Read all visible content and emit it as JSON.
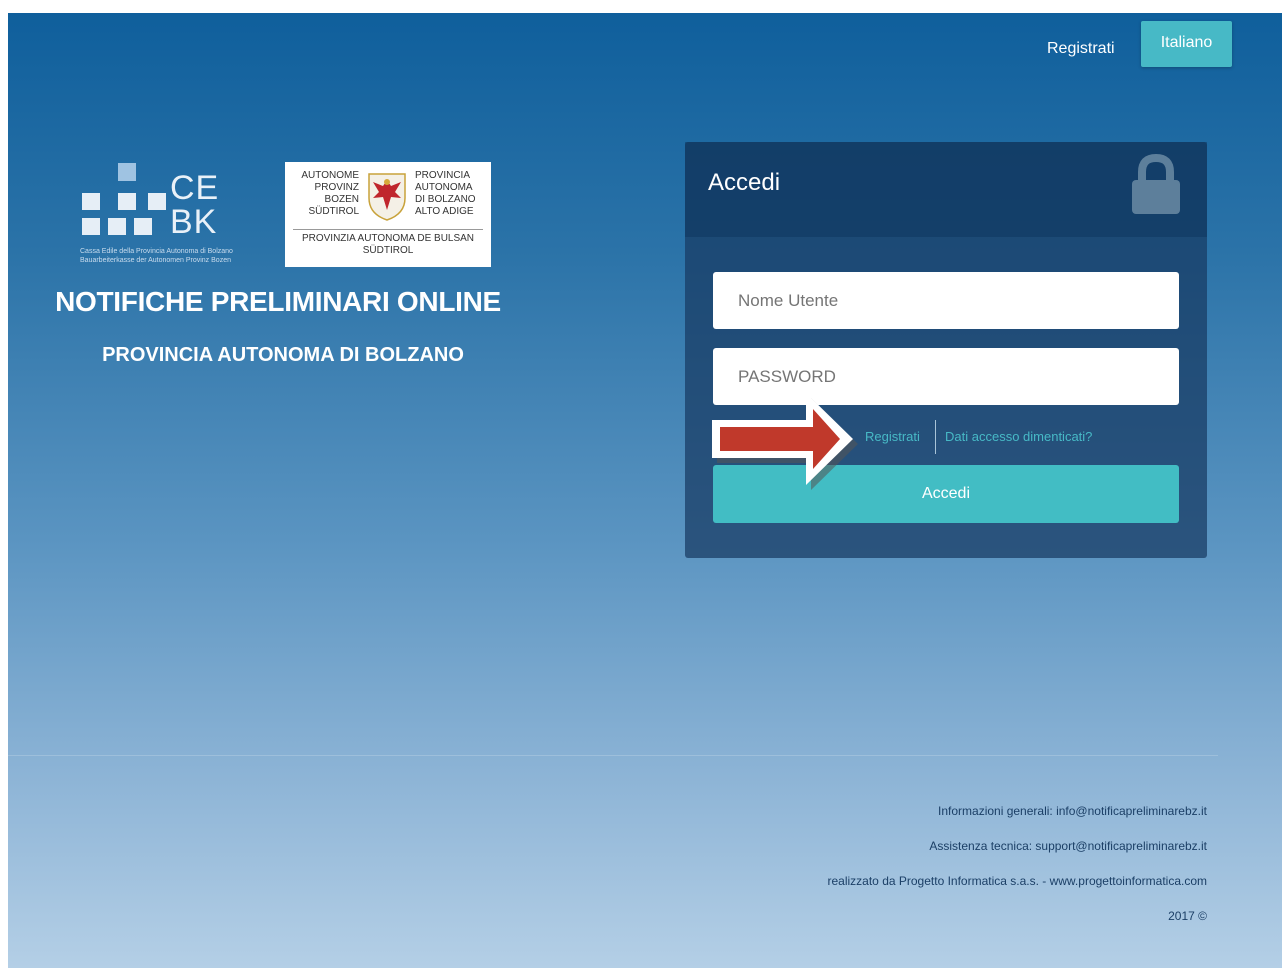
{
  "nav": {
    "register_label": "Registrati",
    "language_label": "Italiano"
  },
  "logos": {
    "cebk": {
      "letters_line1": "CE",
      "letters_line2": "BK",
      "caption_line1": "Cassa Edile della Provincia Autonoma di Bolzano",
      "caption_line2": "Bauarbeiterkasse der Autonomen Provinz Bozen"
    },
    "province": {
      "left_lines": [
        "AUTONOME",
        "PROVINZ",
        "BOZEN",
        "SÜDTIROL"
      ],
      "right_lines": [
        "PROVINCIA",
        "AUTONOMA",
        "DI BOLZANO",
        "ALTO ADIGE"
      ],
      "bottom_line1": "PROVINZIA AUTONOMA DE BULSAN",
      "bottom_line2": "SÜDTIROL"
    }
  },
  "hero": {
    "title": "NOTIFICHE PRELIMINARI ONLINE",
    "subtitle": "PROVINCIA AUTONOMA DI BOLZANO"
  },
  "login": {
    "title": "Accedi",
    "username_placeholder": "Nome Utente",
    "password_placeholder": "PASSWORD",
    "register_link": "Registrati",
    "forgot_link": "Dati accesso dimenticati?",
    "submit_label": "Accedi"
  },
  "footer": {
    "info": "Informazioni generali: info@notificapreliminarebz.it",
    "support": "Assistenza tecnica: support@notificapreliminarebz.it",
    "credit": "realizzato da Progetto Informatica s.a.s. - www.progettoinformatica.com",
    "year": "2017 ©"
  },
  "colors": {
    "accent": "#47b9c6",
    "button": "#42bdc4",
    "annotation_arrow": "#c0392b"
  },
  "icons": [
    "lock-icon",
    "crest-icon",
    "arrow-annotation-icon"
  ]
}
